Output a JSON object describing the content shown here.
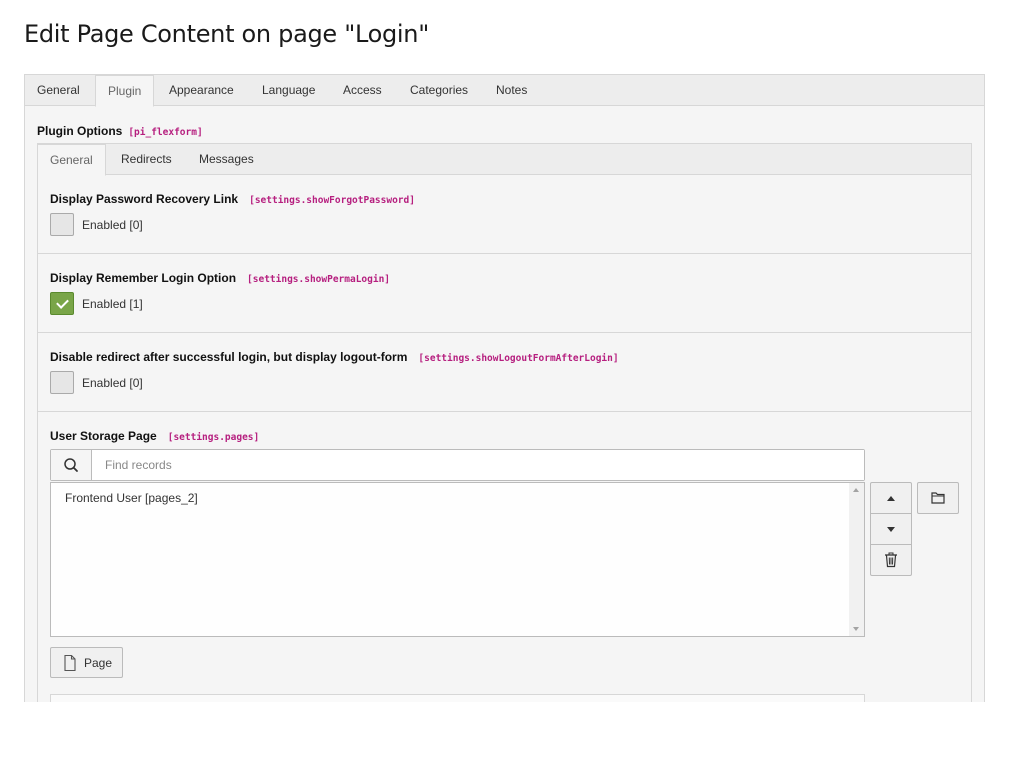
{
  "page": {
    "title": "Edit Page Content on page \"Login\""
  },
  "main_tabs": [
    {
      "label": "General"
    },
    {
      "label": "Plugin"
    },
    {
      "label": "Appearance"
    },
    {
      "label": "Language"
    },
    {
      "label": "Access"
    },
    {
      "label": "Categories"
    },
    {
      "label": "Notes"
    }
  ],
  "plugin_options": {
    "label": "Plugin Options",
    "code": "[pi_flexform]"
  },
  "sub_tabs": [
    {
      "label": "General"
    },
    {
      "label": "Redirects"
    },
    {
      "label": "Messages"
    }
  ],
  "fields": {
    "show_forgot_password": {
      "label": "Display Password Recovery Link",
      "code": "[settings.showForgotPassword]",
      "checked": false,
      "checkbox_text": "Enabled [0]"
    },
    "show_perma_login": {
      "label": "Display Remember Login Option",
      "code": "[settings.showPermaLogin]",
      "checked": true,
      "checkbox_text": "Enabled [1]"
    },
    "show_logout_form": {
      "label": "Disable redirect after successful login, but display logout-form",
      "code": "[settings.showLogoutFormAfterLogin]",
      "checked": false,
      "checkbox_text": "Enabled [0]"
    },
    "user_storage_page": {
      "label": "User Storage Page",
      "code": "[settings.pages]",
      "search_placeholder": "Find records",
      "records": [
        "Frontend User [pages_2]"
      ],
      "add_button_label": "Page"
    }
  },
  "colors": {
    "accent_checked": "#79a548",
    "code_tag": "#b61f7f"
  }
}
